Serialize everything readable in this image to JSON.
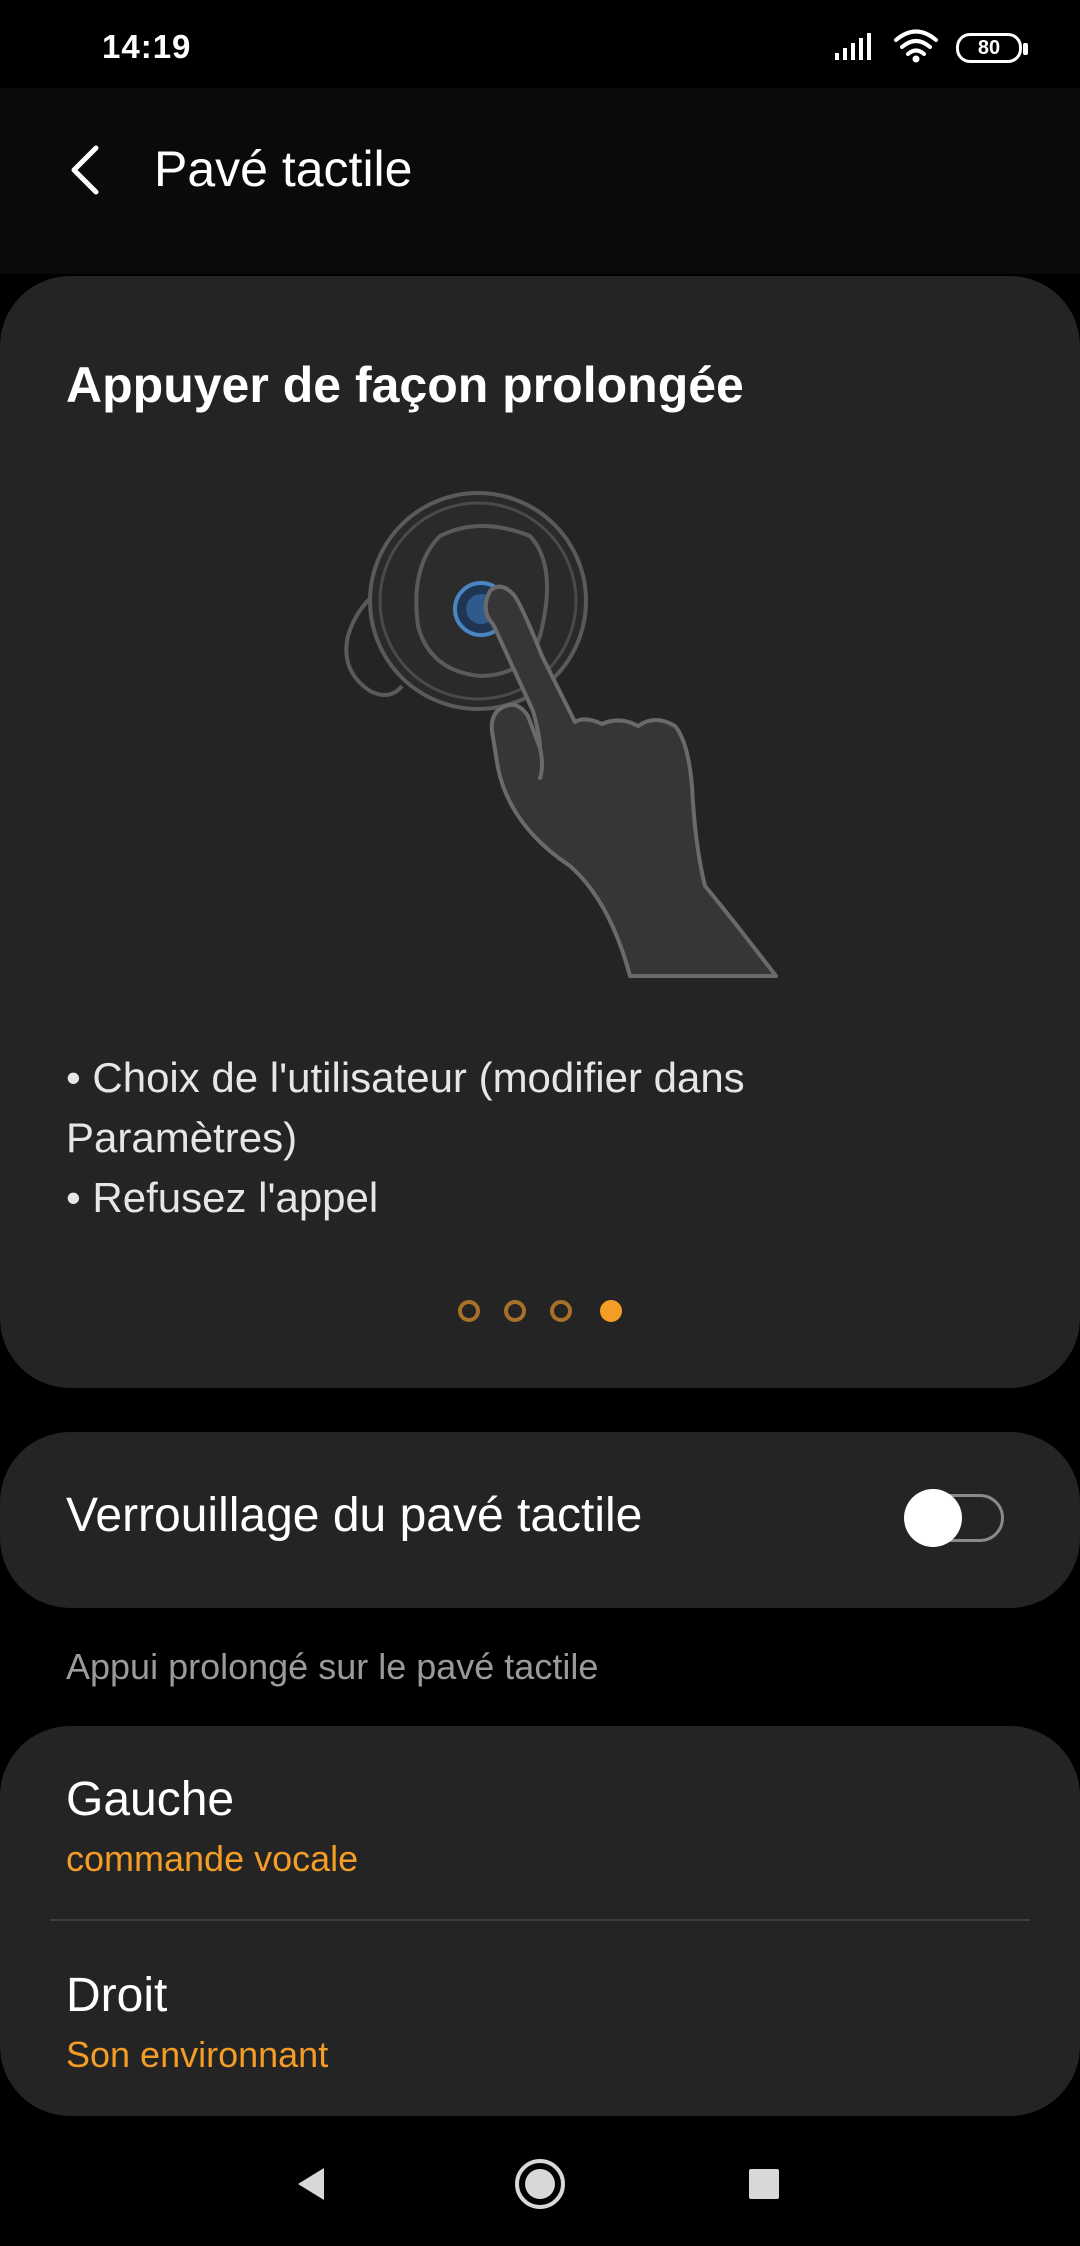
{
  "status_bar": {
    "time": "14:19",
    "battery": "80",
    "icons": [
      "signal-icon",
      "wifi-icon",
      "battery-icon"
    ]
  },
  "header": {
    "title": "Pavé tactile",
    "back_icon": "chevron-left-icon"
  },
  "tutorial": {
    "title": "Appuyer de façon prolongée",
    "illustration": "earbud-long-press-illustration",
    "lines": [
      "• Choix de l'utilisateur (modifier dans Paramètres)",
      "• Refusez l'appel"
    ],
    "page_count": 4,
    "active_page": 4
  },
  "lock": {
    "label": "Verrouillage du pavé tactile",
    "enabled": false
  },
  "section": {
    "heading": "Appui prolongé sur le pavé tactile"
  },
  "options": [
    {
      "title": "Gauche",
      "value": "commande vocale"
    },
    {
      "title": "Droit",
      "value": "Son environnant"
    }
  ],
  "nav": {
    "icons": [
      "back-triangle-icon",
      "home-circle-icon",
      "recents-square-icon"
    ]
  },
  "colors": {
    "accent": "#f39c26",
    "card": "#242424",
    "background": "#000000",
    "touch_point": "#4a86c5"
  }
}
